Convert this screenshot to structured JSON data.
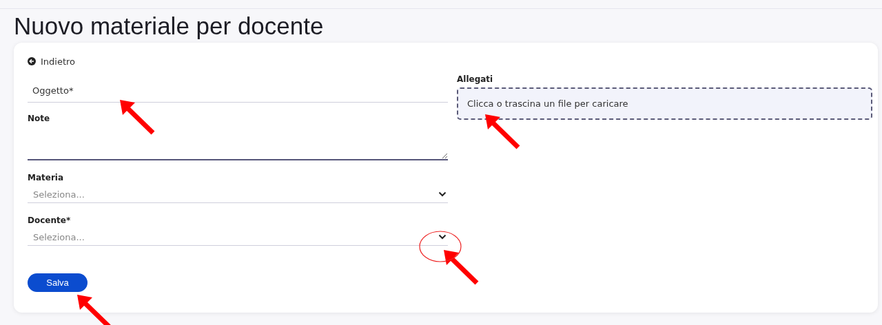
{
  "title": "Nuovo materiale per docente",
  "back_link": "Indietro",
  "fields": [
    {
      "kind": "text",
      "placeholder": "Oggetto*"
    },
    {
      "kind": "textarea",
      "label": "Note"
    },
    {
      "kind": "select",
      "label": "Materia",
      "placeholder": "Seleziona..."
    },
    {
      "kind": "select",
      "label": "Docente*",
      "placeholder": "Seleziona..."
    }
  ],
  "attachments": {
    "label": "Allegati",
    "dropzone": "Clicca o trascina un file per caricare"
  },
  "save_button": "Salva"
}
